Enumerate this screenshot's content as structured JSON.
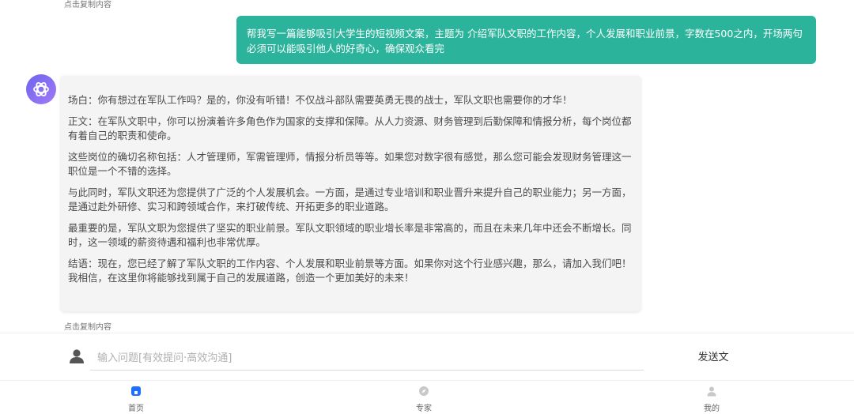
{
  "copy_hint": "点击复制内容",
  "user_message": "帮我写一篇能够吸引大学生的短视频文案，主题为 介绍军队文职的工作内容，个人发展和职业前景，字数在500之内，开场两句必须可以能吸引他人的好奇心，确保观众看完",
  "ai_paragraphs": [
    "场白：你有想过在军队工作吗？是的，你没有听错！不仅战斗部队需要英勇无畏的战士，军队文职也需要你的才华！",
    "正文：在军队文职中，你可以扮演着许多角色作为国家的支撑和保障。从人力资源、财务管理到后勤保障和情报分析，每个岗位都有着自己的职责和使命。",
    "这些岗位的确切名称包括：人才管理师，军需管理师，情报分析员等等。如果您对数字很有感觉，那么您可能会发现财务管理这一职位是一个不错的选择。",
    "与此同时，军队文职还为您提供了广泛的个人发展机会。一方面，是通过专业培训和职业晋升来提升自己的职业能力；另一方面，是通过赴外研修、实习和跨领域合作，来打破传统、开拓更多的职业道路。",
    "最重要的是，军队文职为您提供了坚实的职业前景。军队文职领域的职业增长率是非常高的，而且在未来几年中还会不断增长。同时，这一领域的薪资待遇和福利也非常优厚。",
    "结语：现在，您已经了解了军队文职的工作内容、个人发展和职业前景等方面。如果你对这个行业感兴趣，那么，请加入我们吧！我相信，在这里你将能够找到属于自己的发展道路，创造一个更加美好的未来！"
  ],
  "input": {
    "placeholder": "输入问题[有效提问·高效沟通]",
    "value": ""
  },
  "send_label": "发送文",
  "tabs": [
    {
      "label": "首页",
      "icon": "home-icon",
      "active": true
    },
    {
      "label": "专家",
      "icon": "compass-icon",
      "active": false
    },
    {
      "label": "我的",
      "icon": "user-icon",
      "active": false
    }
  ],
  "colors": {
    "accent": "#2bb39b",
    "tab_active": "#1e6fff",
    "tab_inactive": "#c8c8c8"
  }
}
